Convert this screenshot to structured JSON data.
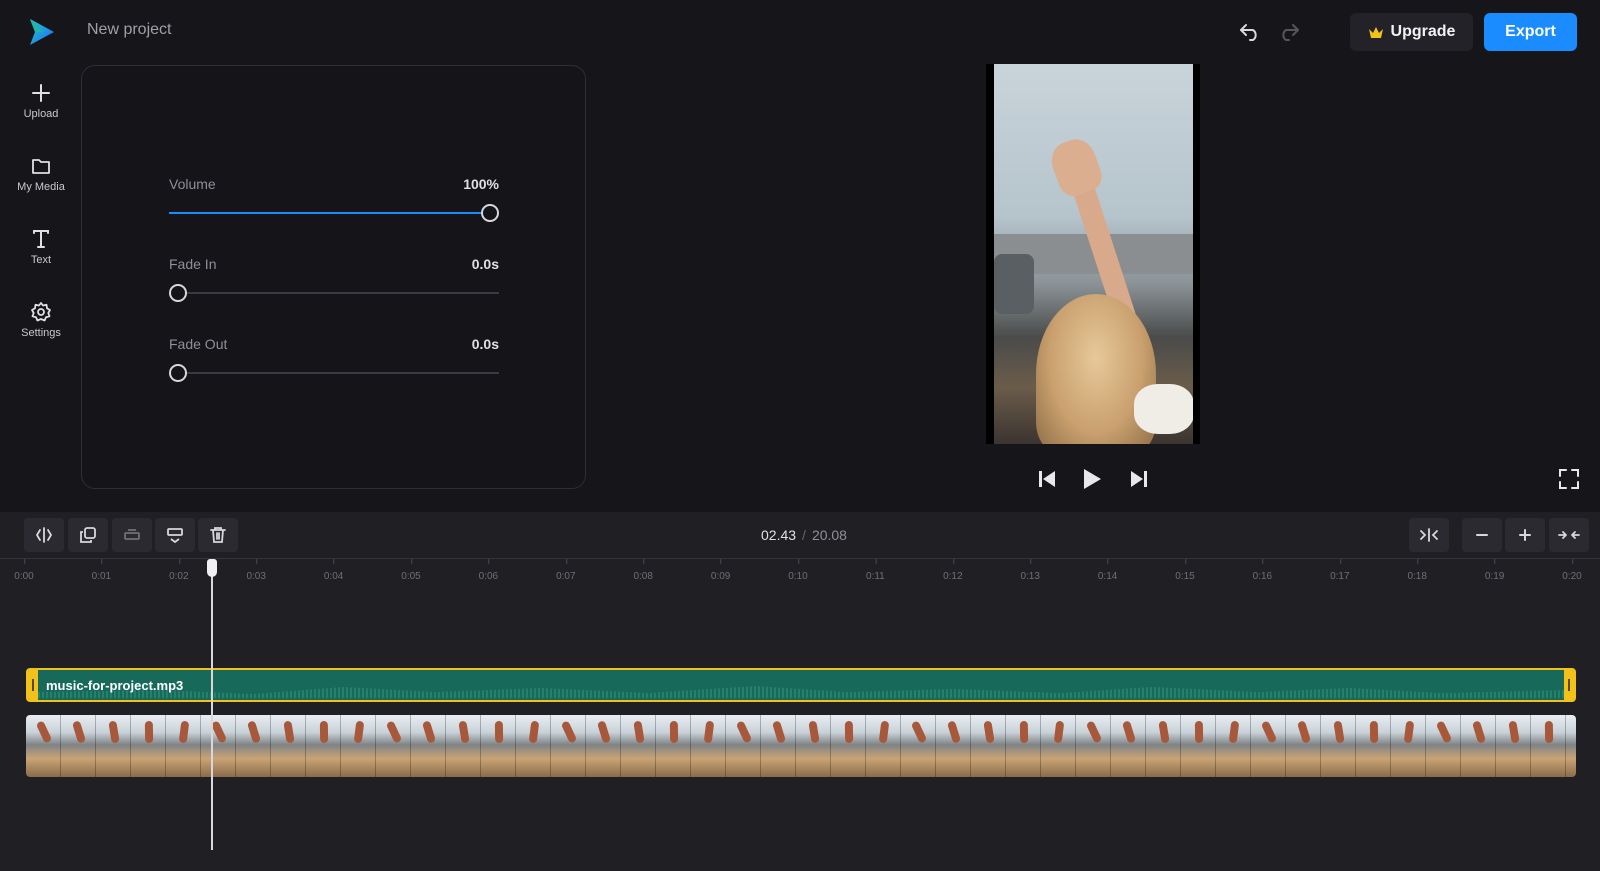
{
  "header": {
    "project_name": "New project",
    "upgrade_label": "Upgrade",
    "export_label": "Export",
    "icons": {
      "logo": "play-logo-icon",
      "undo": "undo-icon",
      "redo": "redo-icon",
      "upgrade": "crown-icon"
    },
    "colors": {
      "accent": "#1a8cff",
      "crown": "#f2c21b"
    }
  },
  "sidebar": {
    "items": [
      {
        "label": "Upload",
        "icon": "plus-icon"
      },
      {
        "label": "My Media",
        "icon": "folder-icon"
      },
      {
        "label": "Text",
        "icon": "text-icon"
      },
      {
        "label": "Settings",
        "icon": "gear-icon"
      }
    ]
  },
  "audio_panel": {
    "volume": {
      "label": "Volume",
      "value_text": "100%",
      "level": 1.0
    },
    "fade_in": {
      "label": "Fade In",
      "value_text": "0.0s",
      "level": 0.0
    },
    "fade_out": {
      "label": "Fade Out",
      "value_text": "0.0s",
      "level": 0.0
    }
  },
  "player": {
    "icons": [
      "skip-back-icon",
      "play-icon",
      "skip-forward-icon",
      "fullscreen-icon"
    ]
  },
  "timeline": {
    "current_time": "02.43",
    "separator": "/",
    "total_time": "20.08",
    "tools_left": [
      "split-icon",
      "duplicate-icon",
      "lift-icon",
      "insert-icon",
      "trash-icon"
    ],
    "tools_right": [
      "fit-icon",
      "zoom-out-icon",
      "zoom-in-icon",
      "collapse-icon"
    ],
    "ruler": [
      "0:00",
      "0:01",
      "0:02",
      "0:03",
      "0:04",
      "0:05",
      "0:06",
      "0:07",
      "0:08",
      "0:09",
      "0:10",
      "0:11",
      "0:12",
      "0:13",
      "0:14",
      "0:15",
      "0:16",
      "0:17",
      "0:18",
      "0:19",
      "0:20"
    ],
    "audio_clip_name": "music-for-project.mp3",
    "playhead_seconds": 2.43
  }
}
